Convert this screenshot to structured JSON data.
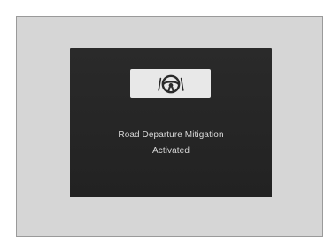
{
  "display": {
    "icon": "road-departure-mitigation-icon",
    "message_line1": "Road Departure Mitigation",
    "message_line2": "Activated"
  },
  "colors": {
    "screen_background": "#262626",
    "icon_box_background": "#e8e8e8",
    "text": "#d8d8d8",
    "panel_background": "#d6d6d6"
  }
}
